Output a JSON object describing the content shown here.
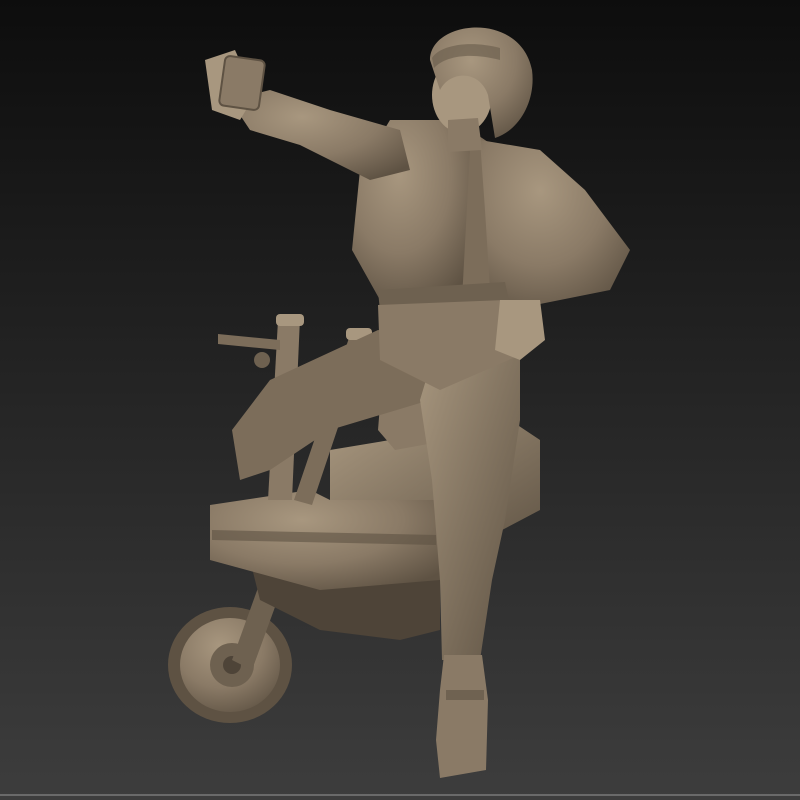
{
  "scene": {
    "subject": "sculpt-render-woman-on-minibike",
    "colors": {
      "bg_top": "#0d0d0d",
      "bg_bottom": "#3d3d3d",
      "clay": "#8a7a66",
      "clay_light": "#a8977f",
      "clay_dark": "#5e5243",
      "clay_shadow": "#3e362c",
      "bottom_line": "#6a6a6a"
    }
  }
}
